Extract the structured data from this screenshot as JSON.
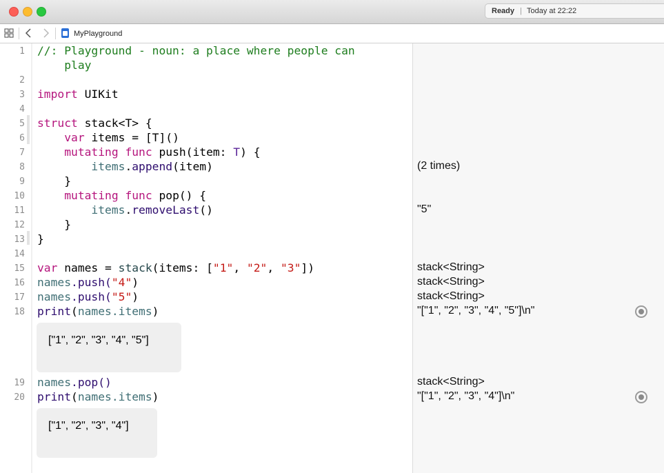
{
  "window": {
    "status_ready": "Ready",
    "status_separator": "|",
    "status_time": "Today at 22:22"
  },
  "jumpbar": {
    "file_name": "MyPlayground",
    "icons": [
      "grid-icon",
      "back-chevron-icon",
      "forward-chevron-icon",
      "playground-file-icon"
    ]
  },
  "editor": {
    "line_numbers": [
      "1",
      "2",
      "3",
      "4",
      "5",
      "6",
      "7",
      "8",
      "9",
      "10",
      "11",
      "12",
      "13",
      "14",
      "15",
      "16",
      "17",
      "18",
      "19",
      "20"
    ],
    "code": {
      "l1_a": "//: Playground - noun: a place where people can",
      "l1_b": "    play",
      "l3_kw": "import",
      "l3_rest": " UIKit",
      "l5_kw": "struct",
      "l5_rest": " stack<T> {",
      "l6_kw": "var",
      "l6_rest": " items = [T]()",
      "l7_kw": "mutating func",
      "l7_a": " push(item: ",
      "l7_ty": "T",
      "l7_b": ") {",
      "l8_prop": "items",
      "l8_dot": ".",
      "l8_method": "append",
      "l8_rest": "(item)",
      "l9": "}",
      "l10_kw": "mutating func",
      "l10_rest": " pop() {",
      "l11_prop": "items",
      "l11_dot": ".",
      "l11_method": "removeLast",
      "l11_rest": "()",
      "l12": "}",
      "l13": "}",
      "l15_kw": "var",
      "l15_a": " names = ",
      "l15_fn": "stack",
      "l15_b": "(items: [",
      "l15_s1": "\"1\"",
      "l15_c1": ", ",
      "l15_s2": "\"2\"",
      "l15_c2": ", ",
      "l15_s3": "\"3\"",
      "l15_end": "])",
      "l16_prop": "names",
      "l16_method": ".push(",
      "l16_str": "\"4\"",
      "l16_end": ")",
      "l17_prop": "names",
      "l17_method": ".push(",
      "l17_str": "\"5\"",
      "l17_end": ")",
      "l18_fn": "print",
      "l18_a": "(",
      "l18_prop": "names.items",
      "l18_end": ")",
      "l19_prop": "names",
      "l19_rest": ".pop()",
      "l20_fn": "print",
      "l20_a": "(",
      "l20_prop": "names.items",
      "l20_end": ")"
    },
    "inline_results": {
      "after_18": "[\"1\", \"2\", \"3\", \"4\", \"5\"]",
      "after_20": "[\"1\", \"2\", \"3\", \"4\"]"
    }
  },
  "results_sidebar": {
    "l8": "(2 times)",
    "l11": "\"5\"",
    "l15": "stack<String>",
    "l16": "stack<String>",
    "l17": "stack<String>",
    "l18": "\"[\"1\", \"2\", \"3\", \"4\", \"5\"]\\n\"",
    "l19": "stack<String>",
    "l20": "\"[\"1\", \"2\", \"3\", \"4\"]\\n\""
  }
}
